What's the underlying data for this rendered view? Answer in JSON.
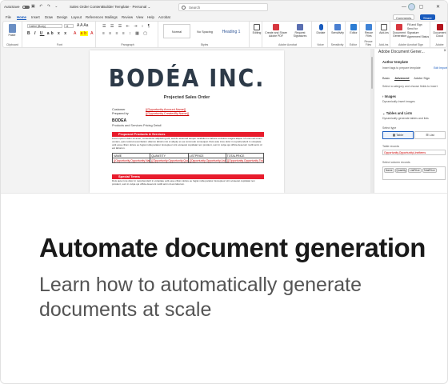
{
  "titlebar": {
    "autosave_label": "AutoSave",
    "autosave_state": "Off",
    "doc_title": "Sales Order ContentBuilder Template",
    "saved_location": "Personal",
    "search_placeholder": "Search"
  },
  "menu": {
    "items": [
      "File",
      "Home",
      "Insert",
      "Draw",
      "Design",
      "Layout",
      "References",
      "Mailings",
      "Review",
      "View",
      "Help",
      "Acrobat"
    ],
    "active": "Home",
    "comments_label": "Comments",
    "editing_label": "Editing",
    "share_label": "Share"
  },
  "ribbon": {
    "paste_label": "Paste",
    "font_name": "Calibri (Body)",
    "font_size": "11",
    "styles": [
      "Normal",
      "No Spacing",
      "Heading 1"
    ],
    "buttons": [
      "Editing",
      "Create and Share Adobe PDF",
      "Request Signatures",
      "Dictate",
      "Sensitivity",
      "Editor",
      "Reuse Files",
      "Add-ins",
      "Document Generation",
      "Document Cloud"
    ],
    "side_buttons": [
      "Fill and Sign",
      "Send for Signature",
      "Agreement Status"
    ],
    "group_labels": [
      "Clipboard",
      "Font",
      "Paragraph",
      "Styles",
      "Adobe Acrobat",
      "Voice",
      "Sensitivity",
      "Editor",
      "Reuse Files",
      "Add-ins",
      "Adobe Acrobat Sign",
      "Adobe"
    ]
  },
  "document": {
    "logo": "BODÉA INC.",
    "title": "Projected Sales Order",
    "customer_label": "Customer",
    "customer_value": "{{Opportunity.Account.Name}}",
    "prepared_label": "Prepared by",
    "prepared_value": "{{Opportunity.CreatedBy.Name}}",
    "company": "BODEA",
    "company_sub": "Products and Services Pricing Detail",
    "section1": "Proposed Products & Services",
    "section1_text": "Lorem ipsum dolor sit amet, consectetur adipiscing elit, sed do eiusmod tempor incididunt ut labore et dolore magna aliqua. Ut enim ad minim veniam, quis nostrud exercitation ullamco laboris nisi ut aliquip ex ea commodo consequat. Duis aute irure dolor in reprehenderit in voluptate velit esse cillum dolore eu fugiat nulla pariatur. Excepteur sint occaecat cupidatat non proident, sunt in culpa qui officia deserunt mollit anim id est laborum.",
    "table_headers": [
      "NAME",
      "QUANTITY",
      "LISTPRICE",
      "TOTALPRICE"
    ],
    "table_row": [
      "{{Opportunity.Opportunity.Name}}",
      "{{Opportunity.Opportunity.Quantity}}",
      "{{Opportunity.Opportunity.ListPrice}}",
      "{{Opportunity.Opportunity.TotalPrice}}"
    ],
    "section2": "Special Terms",
    "section2_text": "Duis aute irure dolor in reprehenderit in voluptate velit esse cillum dolore eu fugiat nulla pariatur. Excepteur sint occaecat cupidatat non proident, sunt in culpa qui officia deserunt mollit anim id est laborum."
  },
  "pane": {
    "title": "Adobe Document Gener...",
    "heading": "Author template",
    "sub": "Insert tags to prepare template",
    "edit_import": "Edit Import",
    "tabs": [
      "Basic",
      "Advanced",
      "Adobe Sign"
    ],
    "active_tab": "Advanced",
    "desc": "Select a category and choose fields to insert",
    "images_title": "Images",
    "images_sub": "Dynamically insert images",
    "tables_title": "Tables and Lists",
    "tables_sub": "Dynamically generate tables and lists",
    "select_type": "Select type",
    "type_table": "Table",
    "type_list": "List",
    "table_records_label": "Table records",
    "table_records_value": "Opportunity.OpportunityLineItems",
    "columns_label": "Select column records",
    "columns": [
      "Name",
      "Quantity",
      "ListPrice",
      "TotalPrice"
    ]
  },
  "promo": {
    "headline": "Automate document generation",
    "subline": "Learn how to automatically generate documents at scale"
  },
  "colors": {
    "accent": "#185abd",
    "section_red": "#e81c2c",
    "tag_red": "#cc0000"
  }
}
